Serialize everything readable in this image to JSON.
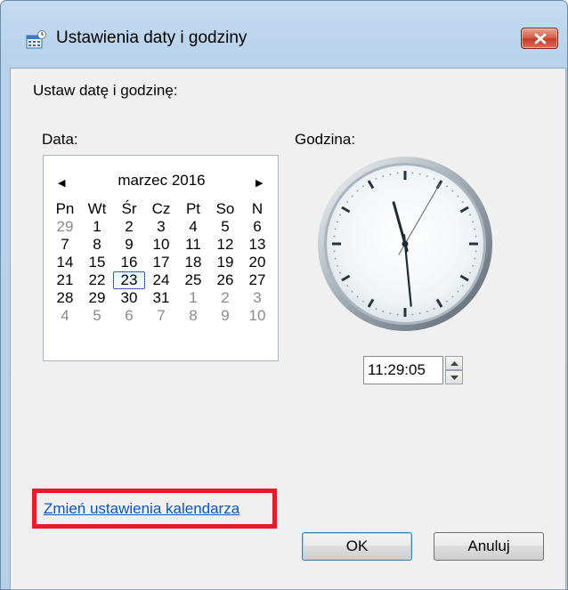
{
  "window": {
    "title": "Ustawienia daty i godziny",
    "close_symbol": "✕"
  },
  "dialog": {
    "heading": "Ustaw datę i godzinę:",
    "date_label": "Data:",
    "time_label": "Godzina:"
  },
  "calendar": {
    "prev_arrow": "◀",
    "next_arrow": "▶",
    "month_year": "marzec 2016",
    "weekdays": [
      "Pn",
      "Wt",
      "Śr",
      "Cz",
      "Pt",
      "So",
      "N"
    ],
    "weeks": [
      [
        "29",
        "1",
        "2",
        "3",
        "4",
        "5",
        "6"
      ],
      [
        "7",
        "8",
        "9",
        "10",
        "11",
        "12",
        "13"
      ],
      [
        "14",
        "15",
        "16",
        "17",
        "18",
        "19",
        "20"
      ],
      [
        "21",
        "22",
        "23",
        "24",
        "25",
        "26",
        "27"
      ],
      [
        "28",
        "29",
        "30",
        "31",
        "1",
        "2",
        "3"
      ],
      [
        "4",
        "5",
        "6",
        "7",
        "8",
        "9",
        "10"
      ]
    ],
    "selected_day": "23"
  },
  "clock": {
    "hours": 11,
    "minutes": 29,
    "seconds": 5
  },
  "time": {
    "value": "11:29:05"
  },
  "link": {
    "text": "Zmień ustawienia kalendarza"
  },
  "buttons": {
    "ok": "OK",
    "cancel": "Anuluj"
  },
  "colors": {
    "link": "#0b55c4",
    "highlight_frame": "#e51b2c"
  }
}
